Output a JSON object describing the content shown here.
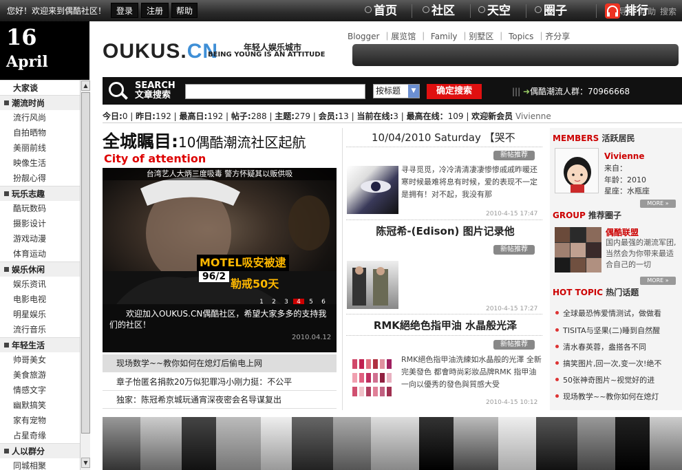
{
  "topbar": {
    "welcome": "您好！欢迎来到偶酷社区！",
    "login": "登录",
    "register": "注册",
    "help": "帮助",
    "right_links": "导航 帮助 搜索"
  },
  "date": {
    "day": "16",
    "month": "April"
  },
  "sidebar": {
    "sections": [
      {
        "title": "大家谈",
        "items": []
      },
      {
        "title": "潮流时尚",
        "items": [
          "流行风尚",
          "自拍晒物",
          "美丽前线",
          "映像生活",
          "扮靓心得"
        ]
      },
      {
        "title": "玩乐志趣",
        "items": [
          "酷玩数码",
          "摄影设计",
          "游戏动漫",
          "体育运动"
        ]
      },
      {
        "title": "娱乐休闲",
        "items": [
          "娱乐资讯",
          "电影电视",
          "明星娱乐",
          "流行音乐"
        ]
      },
      {
        "title": "年轻生活",
        "items": [
          "帅哥美女",
          "美食旅游",
          "情感文字",
          "幽默搞笑",
          "家有宠物",
          "占星奇缘"
        ]
      },
      {
        "title": "人以群分",
        "items": [
          "同城相聚"
        ]
      }
    ]
  },
  "header": {
    "logo_main": "OUKUS.",
    "logo_cn": "CN",
    "tagline": "年轻人娱乐城市",
    "tagline_en": "BEING YOUNG IS AN ATTITUDE",
    "top_links": "Blogger ｜展览馆 ｜ Family ｜别墅区 ｜ Topics ｜齐分享",
    "nav": [
      "首页",
      "社区",
      "天空",
      "圈子",
      "排行"
    ]
  },
  "search": {
    "title_line1": "SEARCH",
    "title_line2": "文章搜索",
    "input_value": "",
    "select_value": "按标题",
    "button": "确定搜索",
    "qq_group": "偶酷潮流人群：70966668"
  },
  "stats": [
    {
      "label": "今日:",
      "value": "0"
    },
    {
      "label": "昨日:",
      "value": "192"
    },
    {
      "label": "最高日:",
      "value": "192"
    },
    {
      "label": "帖子:",
      "value": "288"
    },
    {
      "label": "主题:",
      "value": "279"
    },
    {
      "label": "会员:",
      "value": "13"
    },
    {
      "label": "当前在线:",
      "value": "3"
    },
    {
      "label": "最高在线：",
      "value": "109"
    },
    {
      "label": "欢迎新会员",
      "value": "Vivienne"
    }
  ],
  "feature": {
    "headline": "全城瞩目:",
    "headline_sub": "10偶酷潮流社区起航",
    "city": "City of attention",
    "photo_caption": "台湾艺人大炳三度吸毒 警方怀疑其以贩供吸",
    "calendar": "96/2",
    "motel_line1": "MOTEL吸安被逮",
    "motel_line2": "勒戒50天",
    "pages": [
      "1",
      "2",
      "3",
      "4",
      "5",
      "6"
    ],
    "active_page": "4",
    "intro": "欢迎加入OUKUS.CN偶酷社区，希望大家多多的支持我们的社区！",
    "intro_date": "2010.04.12",
    "links": [
      "现场数学~~教你如何在熄灯后偷电上网",
      "章子怡匿名捐款20万似犯罪冯小刚力挺：不公平",
      "独家：陈冠希京城玩通宵深夜密会名导谋复出"
    ]
  },
  "posts": {
    "first_title": "10/04/2010 Saturday 【哭不",
    "new_tag": "新帖推荐",
    "items": [
      {
        "text": "寻寻觅觅，冷冷清清凄凄惨惨戚戚昨暖还寒时候最难将息有时候，爱的表现不一定是拥有！对不起，我没有那",
        "date": "2010-4-15 17:47",
        "next_title": "陈冠希-(Edison) 图片记录他"
      },
      {
        "text": "",
        "date": "2010-4-15 17:27",
        "next_title": "RMK絕绝色指甲油 水晶般光泽"
      },
      {
        "text": "RMK絕色指甲油洗練如水晶般的光澤 全新完美發色 都會時尚彩妝品牌RMK 指甲油一向以優秀的發色與質感大受",
        "date": "2010-4-15 10:12",
        "next_title": ""
      }
    ]
  },
  "right": {
    "members_title_en": "MEMBERS",
    "members_title": "活跃居民",
    "member_name": "Vivienne",
    "member_from": "来自：",
    "member_age": "年龄：2010",
    "member_star": "星座：水瓶座",
    "group_title_en": "GROUP",
    "group_title": "推荐圈子",
    "group_name": "偶酷联盟",
    "group_desc": "国内最强的潮流军团,当然会为你带来最适合自己的一切",
    "hot_title_en": "HOT TOPIC",
    "hot_title": "热门话题",
    "more": "MORE",
    "hot_items": [
      "全球最恐怖爱情测试，做做看",
      "TISITA与坚果(二)睡到自然醒",
      "清水春英蓉，盎搭各不同",
      "搞笑图片,回一次,变一次!绝不",
      "50张神奇图片~视觉好的进",
      "现场教学~~教你如何在熄灯"
    ]
  },
  "colors": {
    "accent": "#cc0000",
    "bar_dark": "#111111",
    "logo_blue": "#3f8fd6"
  }
}
